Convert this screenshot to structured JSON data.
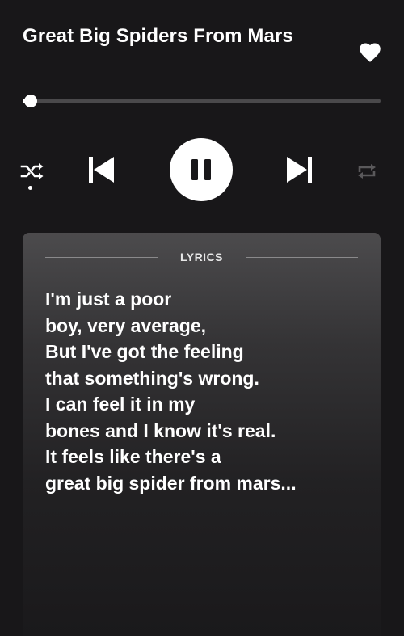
{
  "track": {
    "title": "Great Big Spiders From Mars",
    "liked": true,
    "progress_fraction": 0.023
  },
  "controls": {
    "shuffle_icon": "shuffle-icon",
    "previous_icon": "skip-previous-icon",
    "play_state": "playing",
    "play_pause_icon": "pause-icon",
    "next_icon": "skip-next-icon",
    "repeat_icon": "repeat-icon",
    "shuffle_active": true,
    "repeat_active": false
  },
  "lyrics": {
    "heading": "LYRICS",
    "lines": [
      "I'm just a poor",
      "boy, very average,",
      "But I've got the feeling",
      "that something's wrong.",
      "I can feel it in my",
      "bones and I know it's real.",
      "It feels like there's a",
      "great big spider from mars..."
    ]
  },
  "colors": {
    "background": "#181719",
    "accent": "#ffffff",
    "inactive_icon": "#5a595b",
    "track": "#4a494b"
  }
}
